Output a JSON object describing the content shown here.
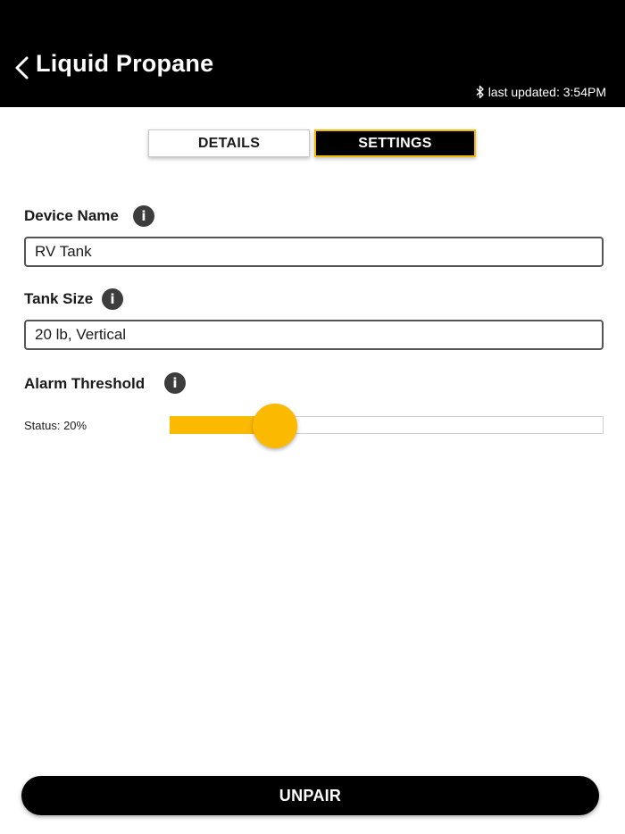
{
  "header": {
    "title": "Liquid Propane",
    "last_updated": "last updated: 3:54PM",
    "back_icon": "chevron-left-icon",
    "status_icon": "bluetooth-icon"
  },
  "tabs": [
    {
      "label": "DETAILS",
      "active": false
    },
    {
      "label": "SETTINGS",
      "active": true
    }
  ],
  "settings": {
    "device_name": {
      "label": "Device Name",
      "value": "RV Tank"
    },
    "tank_size": {
      "label": "Tank Size",
      "value": "20 lb, Vertical"
    },
    "alarm_threshold": {
      "label": "Alarm Threshold",
      "status": "Status: 20%",
      "level_fraction": 0.2
    },
    "info_glyph": "i"
  },
  "footer": {
    "unpair_label": "UNPAIR"
  },
  "colors": {
    "accent": "#fbb900",
    "header_bg": "#000000",
    "icon_bg": "#3d3d3d"
  }
}
